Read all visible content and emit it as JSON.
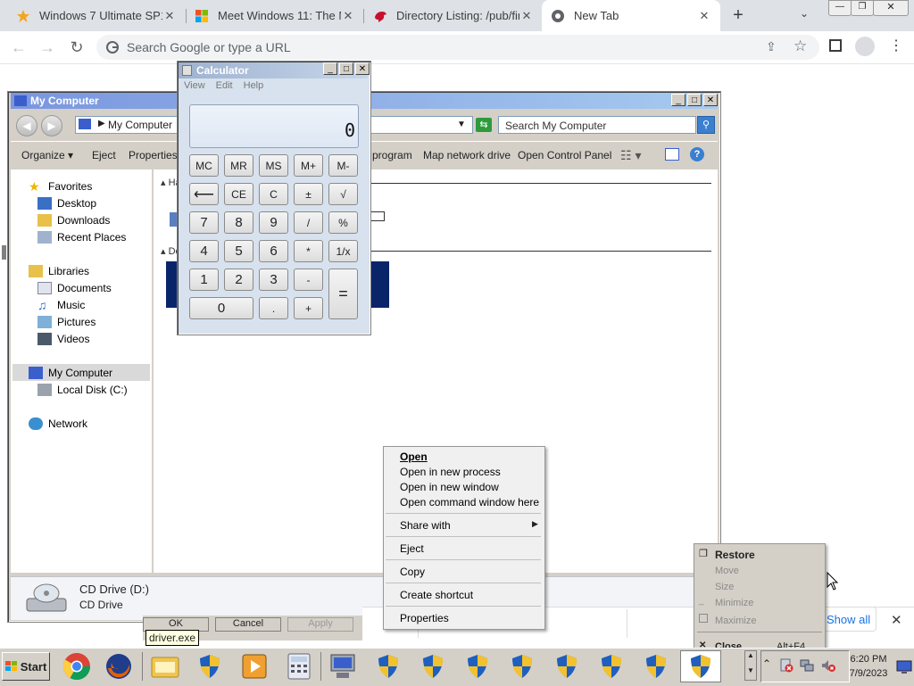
{
  "browser": {
    "tabs": [
      {
        "title": "Windows 7 Ultimate SP1",
        "icon": "star-icon"
      },
      {
        "title": "Meet Windows 11: The N",
        "icon": "windows-logo-icon"
      },
      {
        "title": "Directory Listing: /pub/fin",
        "icon": "red-bird-icon"
      },
      {
        "title": "New Tab",
        "icon": "chrome-icon"
      }
    ],
    "new_tab_label": "+",
    "omnibox_placeholder": "Search Google or type a URL"
  },
  "explorer": {
    "title": "My Computer",
    "address": "My Computer",
    "search_placeholder": "Search My Computer",
    "commands": [
      "Organize",
      "Eject",
      "Properties",
      "program",
      "Map network drive",
      "Open Control Panel"
    ],
    "section_hard_disk": "Ha",
    "section_devices": "De",
    "nav": {
      "favorites": "Favorites",
      "desktop": "Desktop",
      "downloads": "Downloads",
      "recent": "Recent Places",
      "libraries": "Libraries",
      "documents": "Documents",
      "music": "Music",
      "pictures": "Pictures",
      "videos": "Videos",
      "my_computer": "My Computer",
      "local_disk": "Local Disk (C:)",
      "network": "Network"
    },
    "details": {
      "name": "CD Drive (D:)",
      "type": "CD Drive"
    }
  },
  "calculator": {
    "title": "Calculator",
    "menu": [
      "View",
      "Edit",
      "Help"
    ],
    "display": "0",
    "rows": [
      [
        "MC",
        "MR",
        "MS",
        "M+",
        "M-"
      ],
      [
        "⟵",
        "CE",
        "C",
        "±",
        "√"
      ],
      [
        "7",
        "8",
        "9",
        "/",
        "%"
      ],
      [
        "4",
        "5",
        "6",
        "*",
        "1/x"
      ],
      [
        "1",
        "2",
        "3",
        "-"
      ],
      [
        "0",
        ".",
        "+"
      ]
    ],
    "equals": "="
  },
  "context_menu": {
    "items": [
      "Open",
      "Open in new process",
      "Open in new window",
      "Open command window here",
      "Share with",
      "Eject",
      "Copy",
      "Create shortcut",
      "Properties"
    ]
  },
  "system_menu": {
    "items": [
      "Restore",
      "Move",
      "Size",
      "Minimize",
      "Maximize",
      "Close"
    ],
    "close_shortcut": "Alt+F4"
  },
  "dialog_buttons": [
    "OK",
    "Cancel",
    "Apply"
  ],
  "tooltip": "driver.exe",
  "download_bar": {
    "show_all": "Show all"
  },
  "taskbar": {
    "start": "Start",
    "clock_time": "6:20 PM",
    "clock_date": "7/9/2023"
  }
}
